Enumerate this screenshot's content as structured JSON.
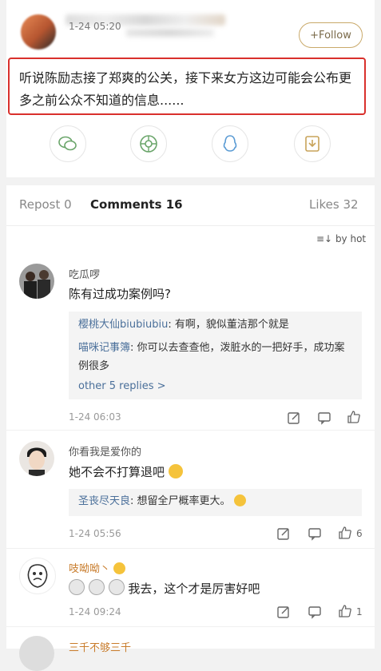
{
  "post": {
    "time": "1-24 05:20",
    "follow_label": "+Follow",
    "text": "听说陈励志接了郑爽的公关，接下来女方这边可能会公布更多之前公众不知道的信息......",
    "share_icons": [
      "wechat-icon",
      "moments-icon",
      "qq-icon",
      "save-icon"
    ]
  },
  "tabs": {
    "repost": "Repost 0",
    "comments": "Comments 16",
    "likes": "Likes 32"
  },
  "sort_label": "by hot",
  "comments": [
    {
      "user": "吃瓜啰",
      "text": "陈有过成功案例吗?",
      "replies": [
        {
          "author": "樱桃大仙biubiubiu",
          "text": ": 有啊，貌似董洁那个就是"
        },
        {
          "author": "喵咪记事簿",
          "text": ": 你可以去查查他，泼脏水的一把好手，成功案例很多"
        }
      ],
      "more": "other 5 replies >",
      "time": "1-24 06:03",
      "likes": ""
    },
    {
      "user": "你看我是爱你的",
      "text": "她不会不打算退吧",
      "replies": [
        {
          "author": "圣丧尽天良",
          "text": ": 想留全尸概率更大。"
        }
      ],
      "time": "1-24 05:56",
      "likes": "6"
    },
    {
      "user": "吱呦呦丶",
      "text": "我去，这个才是厉害好吧",
      "time": "1-24 09:24",
      "likes": "1"
    },
    {
      "user": "三千不够三千"
    }
  ]
}
